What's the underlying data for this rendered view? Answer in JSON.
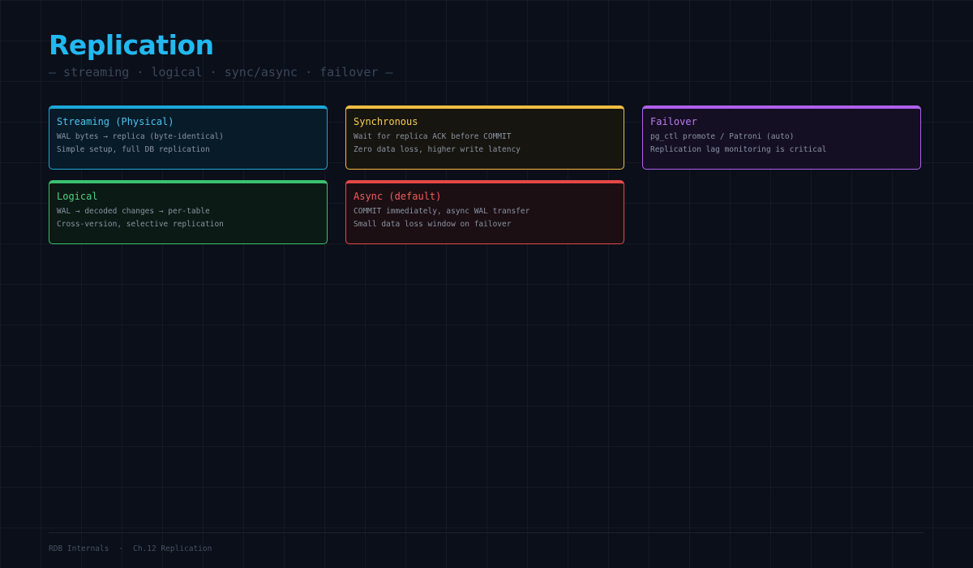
{
  "header": {
    "title": "Replication",
    "subtitle": "— streaming · logical · sync/async · failover —"
  },
  "cards": [
    {
      "title": "Streaming (Physical)",
      "lines": [
        "WAL bytes → replica (byte-identical)",
        "Simple setup, full DB replication"
      ],
      "accent": "#1ba7d8"
    },
    {
      "title": "Synchronous",
      "lines": [
        "Wait for replica ACK before COMMIT",
        "Zero data loss, higher write latency"
      ],
      "accent": "#f2bd42"
    },
    {
      "title": "Failover",
      "lines": [
        "pg_ctl promote / Patroni (auto)",
        "Replication lag monitoring is critical"
      ],
      "accent": "#b060ee"
    },
    {
      "title": "Logical",
      "lines": [
        "WAL → decoded changes → per-table",
        "Cross-version, selective replication"
      ],
      "accent": "#3ac270"
    },
    {
      "title": "Async (default)",
      "lines": [
        "COMMIT immediately, async WAL transfer",
        "Small data loss window on failover"
      ],
      "accent": "#e54848"
    }
  ],
  "footer": {
    "book": "RDB Internals",
    "separator": "·",
    "chapter": "Ch.12 Replication"
  },
  "colors": {
    "background": "#0b0f19",
    "title": "#22b8f0"
  }
}
